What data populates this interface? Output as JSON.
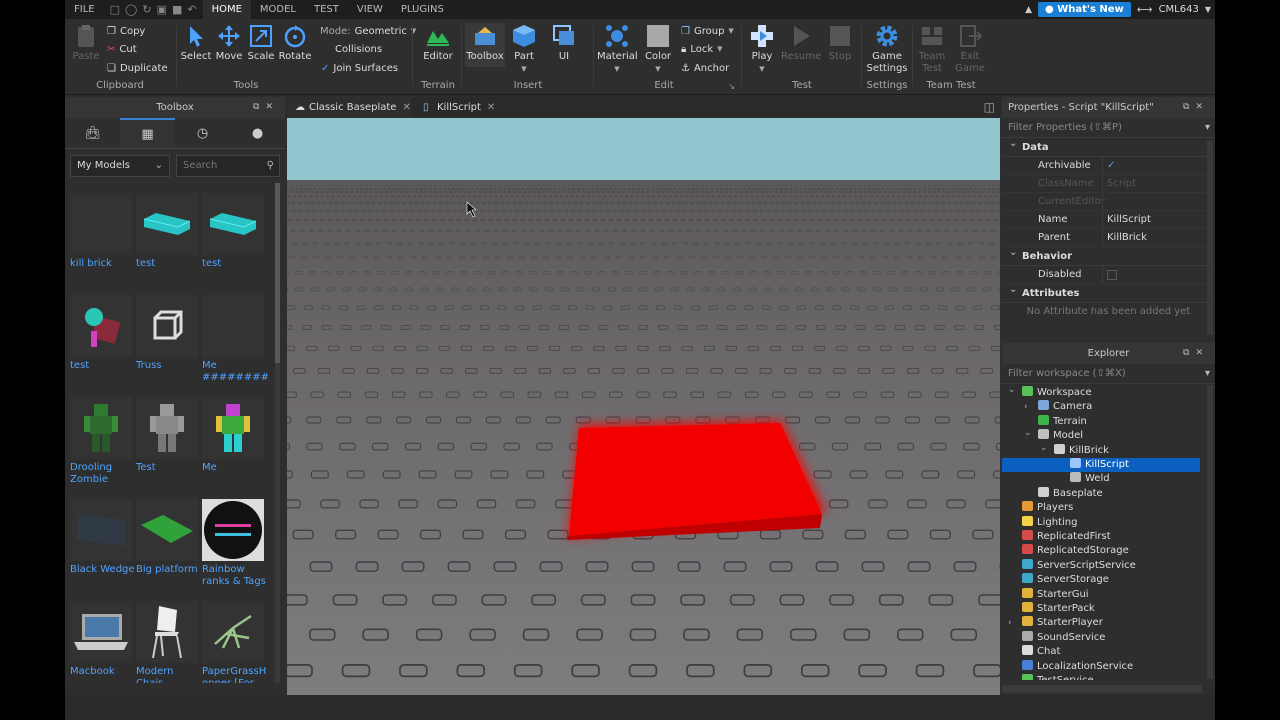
{
  "menubar": {
    "tabs": [
      "FILE",
      "HOME",
      "MODEL",
      "TEST",
      "VIEW",
      "PLUGINS"
    ],
    "active_tab": "HOME",
    "whats_new": "What's New",
    "username": "CML643"
  },
  "ribbon": {
    "clipboard": {
      "paste": "Paste",
      "copy": "Copy",
      "cut": "Cut",
      "duplicate": "Duplicate",
      "label": "Clipboard"
    },
    "tools": {
      "select": "Select",
      "move": "Move",
      "scale": "Scale",
      "rotate": "Rotate",
      "mode_label": "Mode:",
      "mode_value": "Geometric",
      "collisions": "Collisions",
      "join_surfaces": "Join Surfaces",
      "label": "Tools"
    },
    "terrain": {
      "editor": "Editor",
      "label": "Terrain"
    },
    "insert": {
      "toolbox": "Toolbox",
      "part": "Part",
      "ui": "UI",
      "label": "Insert"
    },
    "edit": {
      "material": "Material",
      "color": "Color",
      "group": "Group",
      "lock": "Lock",
      "anchor": "Anchor",
      "label": "Edit"
    },
    "test": {
      "play": "Play",
      "resume": "Resume",
      "stop": "Stop",
      "label": "Test"
    },
    "settings": {
      "game_settings_1": "Game",
      "game_settings_2": "Settings",
      "label": "Settings"
    },
    "team_test": {
      "team_test_1": "Team",
      "team_test_2": "Test",
      "exit_game_1": "Exit",
      "exit_game_2": "Game",
      "label": "Team Test"
    }
  },
  "toolbox": {
    "title": "Toolbox",
    "category": "My Models",
    "search_placeholder": "Search",
    "items": [
      {
        "name": "kill brick"
      },
      {
        "name": "test"
      },
      {
        "name": "test"
      },
      {
        "name": "test"
      },
      {
        "name": "Truss"
      },
      {
        "name": "Me ##########"
      },
      {
        "name": "Drooling Zombie"
      },
      {
        "name": "Test"
      },
      {
        "name": "Me"
      },
      {
        "name": "Black Wedge"
      },
      {
        "name": "Big platform"
      },
      {
        "name": "Rainbow ranks & Tags"
      },
      {
        "name": "Macbook"
      },
      {
        "name": "Modern Chair"
      },
      {
        "name": "PaperGrassH opper [For..."
      }
    ]
  },
  "doc_tabs": [
    {
      "label": "Classic Baseplate"
    },
    {
      "label": "KillScript"
    }
  ],
  "properties": {
    "title": "Properties - Script \"KillScript\"",
    "filter_placeholder": "Filter Properties (⇧⌘P)",
    "sections": {
      "data": "Data",
      "behavior": "Behavior",
      "attributes": "Attributes"
    },
    "rows": {
      "archivable": {
        "key": "Archivable",
        "value": "✓"
      },
      "classname": {
        "key": "ClassName",
        "value": "Script"
      },
      "currenteditor": {
        "key": "CurrentEditor",
        "value": ""
      },
      "name": {
        "key": "Name",
        "value": "KillScript"
      },
      "parent": {
        "key": "Parent",
        "value": "KillBrick"
      },
      "disabled": {
        "key": "Disabled",
        "value": ""
      }
    },
    "no_attributes": "No Attribute has been added yet"
  },
  "explorer": {
    "title": "Explorer",
    "filter_placeholder": "Filter workspace (⇧⌘X)",
    "items": [
      {
        "label": "Workspace",
        "color": "#5bc25b"
      },
      {
        "label": "Camera",
        "color": "#7ea6d8"
      },
      {
        "label": "Terrain",
        "color": "#3fb44a"
      },
      {
        "label": "Model",
        "color": "#c0c0c0"
      },
      {
        "label": "KillBrick",
        "color": "#d0d0d0"
      },
      {
        "label": "KillScript",
        "color": "#9cc6ff"
      },
      {
        "label": "Weld",
        "color": "#bbbbbb"
      },
      {
        "label": "Baseplate",
        "color": "#d0d0d0"
      },
      {
        "label": "Players",
        "color": "#e59a3a"
      },
      {
        "label": "Lighting",
        "color": "#f3d34a"
      },
      {
        "label": "ReplicatedFirst",
        "color": "#d74a4a"
      },
      {
        "label": "ReplicatedStorage",
        "color": "#d74a4a"
      },
      {
        "label": "ServerScriptService",
        "color": "#3fa7c9"
      },
      {
        "label": "ServerStorage",
        "color": "#3fa7c9"
      },
      {
        "label": "StarterGui",
        "color": "#e2b33c"
      },
      {
        "label": "StarterPack",
        "color": "#e2b33c"
      },
      {
        "label": "StarterPlayer",
        "color": "#e2b33c"
      },
      {
        "label": "SoundService",
        "color": "#aaaaaa"
      },
      {
        "label": "Chat",
        "color": "#dddddd"
      },
      {
        "label": "LocalizationService",
        "color": "#4a7fd7"
      },
      {
        "label": "TestService",
        "color": "#5bc25b"
      }
    ]
  }
}
